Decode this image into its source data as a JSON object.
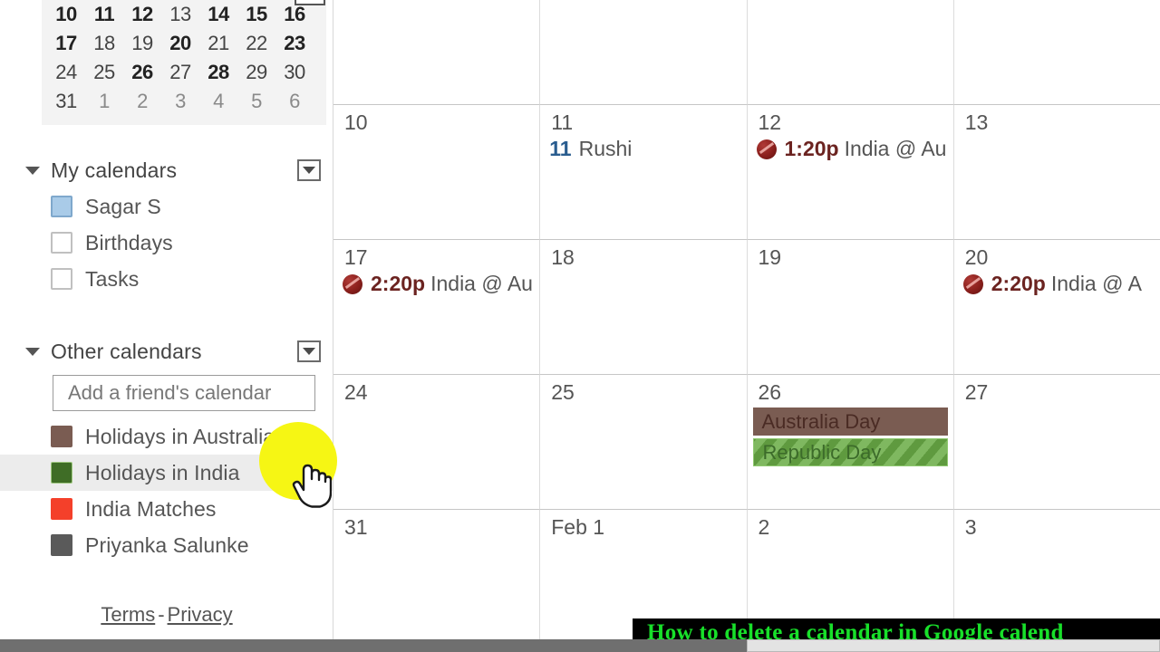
{
  "mini_calendar": {
    "rows": [
      [
        {
          "d": "10",
          "style": "bold"
        },
        {
          "d": "11",
          "style": "bold"
        },
        {
          "d": "12",
          "style": "bold"
        },
        {
          "d": "13",
          "style": "normal"
        },
        {
          "d": "14",
          "style": "bold"
        },
        {
          "d": "15",
          "style": "bold"
        },
        {
          "d": "16",
          "style": "bold"
        }
      ],
      [
        {
          "d": "17",
          "style": "bold"
        },
        {
          "d": "18",
          "style": "normal"
        },
        {
          "d": "19",
          "style": "normal"
        },
        {
          "d": "20",
          "style": "bold"
        },
        {
          "d": "21",
          "style": "normal"
        },
        {
          "d": "22",
          "style": "normal"
        },
        {
          "d": "23",
          "style": "bold"
        }
      ],
      [
        {
          "d": "24",
          "style": "normal"
        },
        {
          "d": "25",
          "style": "normal"
        },
        {
          "d": "26",
          "style": "bold"
        },
        {
          "d": "27",
          "style": "normal"
        },
        {
          "d": "28",
          "style": "bold"
        },
        {
          "d": "29",
          "style": "normal"
        },
        {
          "d": "30",
          "style": "normal"
        }
      ],
      [
        {
          "d": "31",
          "style": "normal"
        },
        {
          "d": "1",
          "style": "muted"
        },
        {
          "d": "2",
          "style": "muted"
        },
        {
          "d": "3",
          "style": "muted"
        },
        {
          "d": "4",
          "style": "muted"
        },
        {
          "d": "5",
          "style": "muted"
        },
        {
          "d": "6",
          "style": "muted"
        }
      ]
    ]
  },
  "sidebar": {
    "my_calendars": {
      "title": "My calendars",
      "items": [
        {
          "label": "Sagar S",
          "color": "#a9cbe8",
          "checked": true
        },
        {
          "label": "Birthdays",
          "color": "",
          "checked": false
        },
        {
          "label": "Tasks",
          "color": "",
          "checked": false
        }
      ]
    },
    "other_calendars": {
      "title": "Other calendars",
      "add_friend_placeholder": "Add a friend's calendar",
      "items": [
        {
          "label": "Holidays in Australia",
          "color": "#7a5c52",
          "checked": true,
          "hovered": false
        },
        {
          "label": "Holidays in India",
          "color": "#3f6d26",
          "checked": true,
          "hovered": true
        },
        {
          "label": "India Matches",
          "color": "#f4402a",
          "checked": true,
          "hovered": false
        },
        {
          "label": "Priyanka Salunke",
          "color": "#5a5a5a",
          "checked": true,
          "hovered": false
        }
      ]
    },
    "footer": {
      "terms": "Terms",
      "separator": "-",
      "privacy": "Privacy"
    }
  },
  "grid": {
    "weeks": [
      {
        "partial": true,
        "days": [
          {
            "num": "",
            "events": []
          },
          {
            "num": "",
            "events": []
          },
          {
            "num": "",
            "events": []
          },
          {
            "num": "",
            "events": []
          }
        ]
      },
      {
        "partial": false,
        "days": [
          {
            "num": "10",
            "events": []
          },
          {
            "num": "11",
            "events": [
              {
                "kind": "birthday",
                "lead": "11",
                "text": "Rushi"
              }
            ]
          },
          {
            "num": "12",
            "events": [
              {
                "kind": "match",
                "time": "1:20p",
                "text": "India @ Au"
              }
            ]
          },
          {
            "num": "13",
            "events": []
          }
        ]
      },
      {
        "partial": false,
        "days": [
          {
            "num": "17",
            "events": [
              {
                "kind": "match",
                "time": "2:20p",
                "text": "India @ Au"
              }
            ]
          },
          {
            "num": "18",
            "events": []
          },
          {
            "num": "19",
            "events": []
          },
          {
            "num": "20",
            "events": [
              {
                "kind": "match",
                "time": "2:20p",
                "text": "India @ A"
              }
            ]
          }
        ]
      },
      {
        "partial": false,
        "days": [
          {
            "num": "24",
            "events": []
          },
          {
            "num": "25",
            "events": []
          },
          {
            "num": "26",
            "events": [
              {
                "kind": "band-brown",
                "text": "Australia Day"
              },
              {
                "kind": "band-green",
                "text": "Republic Day"
              }
            ]
          },
          {
            "num": "27",
            "events": []
          }
        ]
      },
      {
        "partial": false,
        "days": [
          {
            "num": "31",
            "events": []
          },
          {
            "num": "Feb 1",
            "events": []
          },
          {
            "num": "2",
            "events": []
          },
          {
            "num": "3",
            "events": []
          }
        ]
      }
    ]
  },
  "banner": {
    "text": "How to delete a calendar in Google calend"
  }
}
